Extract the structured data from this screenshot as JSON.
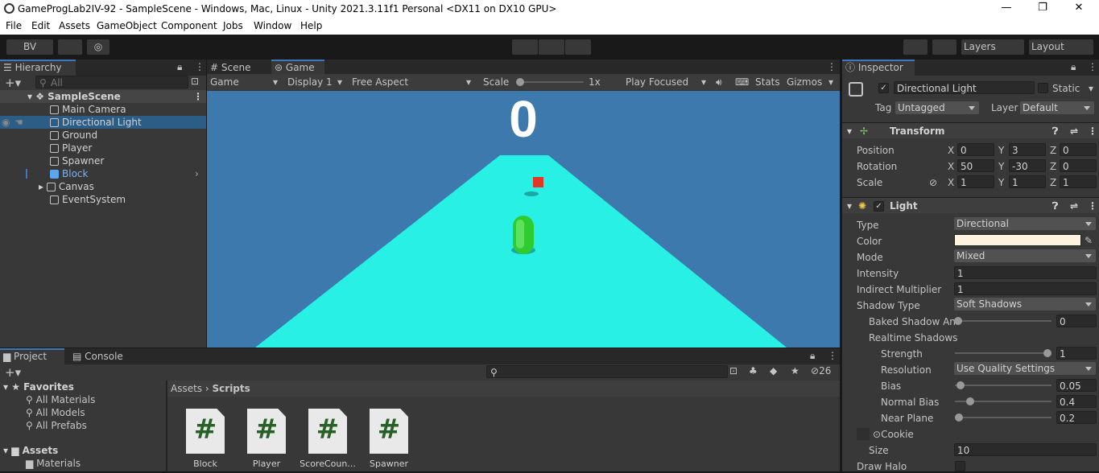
{
  "window": {
    "title": "GameProgLab2IV-92 - SampleScene - Windows, Mac, Linux - Unity 2021.3.11f1 Personal <DX11 on DX10 GPU>",
    "minimize": "—",
    "restore": "❐",
    "close": "✕"
  },
  "menu": [
    "File",
    "Edit",
    "Assets",
    "GameObject",
    "Component",
    "Jobs",
    "Window",
    "Help"
  ],
  "toolbar": {
    "account": "BV",
    "layers": "Layers",
    "layout": "Layout"
  },
  "hierarchy": {
    "tab": "Hierarchy",
    "search_placeholder": "All",
    "scene": "SampleScene",
    "items": [
      {
        "label": "Main Camera"
      },
      {
        "label": "Directional Light"
      },
      {
        "label": "Ground"
      },
      {
        "label": "Player"
      },
      {
        "label": "Spawner"
      },
      {
        "label": "Block"
      },
      {
        "label": "Canvas"
      },
      {
        "label": "EventSystem"
      }
    ]
  },
  "view_tabs": {
    "scene": "Scene",
    "game": "Game"
  },
  "game_toolbar": {
    "mode": "Game",
    "display": "Display 1",
    "aspect": "Free Aspect",
    "scale_label": "Scale",
    "scale_value": "1x",
    "play_mode": "Play Focused",
    "stats": "Stats",
    "gizmos": "Gizmos"
  },
  "game_view": {
    "score": "0"
  },
  "colors": {
    "sky": "#3d79ac",
    "ground": "#29f0e4",
    "player": "#2ecc2e",
    "block": "#e03826",
    "accent": "#3a79bb",
    "light_color": "#fdf3de"
  },
  "project": {
    "tabs": {
      "project": "Project",
      "console": "Console"
    },
    "hidden_count": "26",
    "favorites": {
      "title": "Favorites",
      "items": [
        "All Materials",
        "All Models",
        "All Prefabs"
      ]
    },
    "assets_title": "Assets",
    "assets_items": [
      "Materials"
    ],
    "breadcrumb": {
      "root": "Assets",
      "current": "Scripts"
    },
    "scripts": [
      {
        "glyph": "#",
        "name": "Block"
      },
      {
        "glyph": "#",
        "name": "Player"
      },
      {
        "glyph": "#",
        "name": "ScoreCoun..."
      },
      {
        "glyph": "#",
        "name": "Spawner"
      }
    ]
  },
  "inspector": {
    "tab": "Inspector",
    "object_name": "Directional Light",
    "static_label": "Static",
    "tag_label": "Tag",
    "tag_value": "Untagged",
    "layer_label": "Layer",
    "layer_value": "Default",
    "transform": {
      "title": "Transform",
      "position": {
        "label": "Position",
        "x": "0",
        "y": "3",
        "z": "0"
      },
      "rotation": {
        "label": "Rotation",
        "x": "50",
        "y": "-30",
        "z": "0"
      },
      "scale": {
        "label": "Scale",
        "x": "1",
        "y": "1",
        "z": "1"
      }
    },
    "light": {
      "title": "Light",
      "type_label": "Type",
      "type_value": "Directional",
      "color_label": "Color",
      "mode_label": "Mode",
      "mode_value": "Mixed",
      "intensity_label": "Intensity",
      "intensity_value": "1",
      "indirect_label": "Indirect Multiplier",
      "indirect_value": "1",
      "shadow_type_label": "Shadow Type",
      "shadow_type_value": "Soft Shadows",
      "baked_label": "Baked Shadow An",
      "baked_value": "0",
      "realtime_label": "Realtime Shadows",
      "strength_label": "Strength",
      "strength_value": "1",
      "resolution_label": "Resolution",
      "resolution_value": "Use Quality Settings",
      "bias_label": "Bias",
      "bias_value": "0.05",
      "normal_bias_label": "Normal Bias",
      "normal_bias_value": "0.4",
      "near_plane_label": "Near Plane",
      "near_plane_value": "0.2",
      "cookie_label": "Cookie",
      "size_label": "Size",
      "size_value": "10",
      "draw_halo_label": "Draw Halo"
    }
  }
}
